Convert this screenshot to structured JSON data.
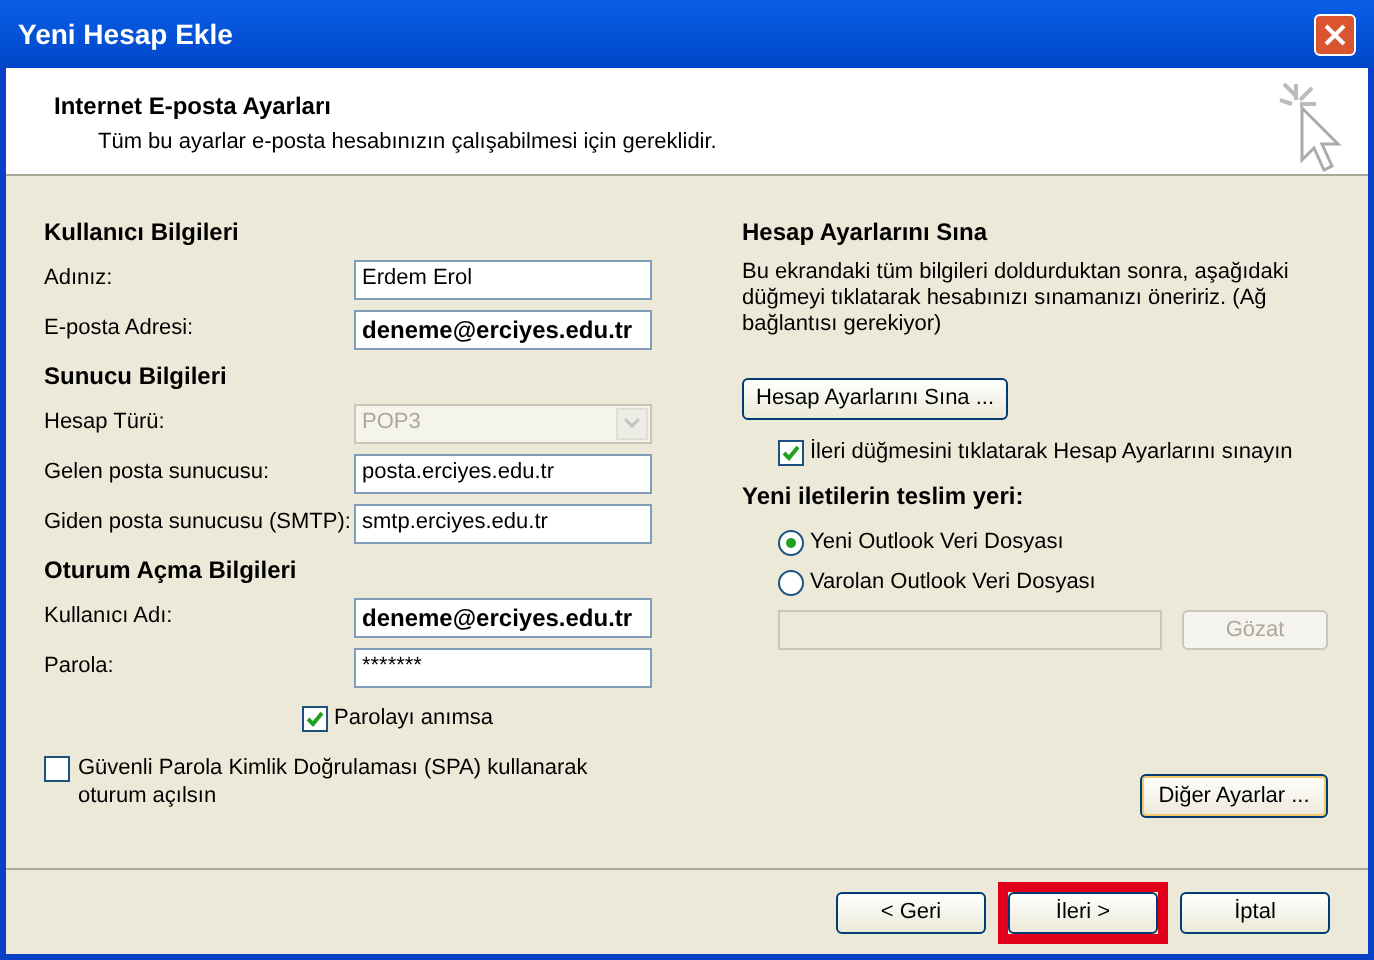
{
  "window": {
    "title": "Yeni Hesap Ekle"
  },
  "header": {
    "title": "Internet E-posta Ayarları",
    "subtitle": "Tüm bu ayarlar e-posta hesabınızın çalışabilmesi için gereklidir."
  },
  "left_groups": [
    {
      "heading": "Kullanıcı Bilgileri",
      "fields": [
        {
          "label": "Adınız:",
          "value": "Erdem Erol",
          "bold": false,
          "kind": "text"
        },
        {
          "label": "E-posta Adresi:",
          "value": "deneme@erciyes.edu.tr",
          "bold": true,
          "kind": "text"
        }
      ]
    },
    {
      "heading": "Sunucu Bilgileri",
      "fields": [
        {
          "label": "Hesap Türü:",
          "value": "POP3",
          "disabled": true,
          "kind": "select"
        },
        {
          "label": "Gelen posta sunucusu:",
          "value": "posta.erciyes.edu.tr",
          "bold": false,
          "kind": "text"
        },
        {
          "label": "Giden posta sunucusu (SMTP):",
          "value": "smtp.erciyes.edu.tr",
          "bold": false,
          "kind": "text"
        }
      ]
    },
    {
      "heading": "Oturum Açma Bilgileri",
      "fields": [
        {
          "label": "Kullanıcı Adı:",
          "value": "deneme@erciyes.edu.tr",
          "bold": true,
          "kind": "text"
        },
        {
          "label": "Parola:",
          "value": "*******",
          "bold": false,
          "kind": "text"
        }
      ]
    }
  ],
  "remember_password": {
    "label": "Parolayı anımsa",
    "checked": true
  },
  "spa": {
    "label": "Güvenli Parola Kimlik Doğrulaması (SPA) kullanarak oturum açılsın",
    "checked": false
  },
  "test": {
    "heading": "Hesap Ayarlarını Sına",
    "description": "Bu ekrandaki tüm bilgileri doldurduktan sonra, aşağıdaki düğmeyi tıklatarak hesabınızı sınamanızı öneririz. (Ağ bağlantısı gerekiyor)",
    "button": "Hesap Ayarlarını Sına ...",
    "checkbox": {
      "label": "İleri düğmesini tıklatarak Hesap Ayarlarını sınayın",
      "checked": true
    }
  },
  "delivery": {
    "heading": "Yeni iletilerin teslim yeri:",
    "options": [
      {
        "label": "Yeni Outlook Veri Dosyası",
        "selected": true
      },
      {
        "label": "Varolan Outlook Veri Dosyası",
        "selected": false
      }
    ],
    "browse_button": {
      "label": "Gözat",
      "disabled": true
    }
  },
  "more_settings": "Diğer Ayarlar ...",
  "buttons": [
    {
      "label": "< Geri",
      "highlighted": false
    },
    {
      "label": "İleri >",
      "highlighted": true
    },
    {
      "label": "İptal",
      "highlighted": false
    }
  ]
}
